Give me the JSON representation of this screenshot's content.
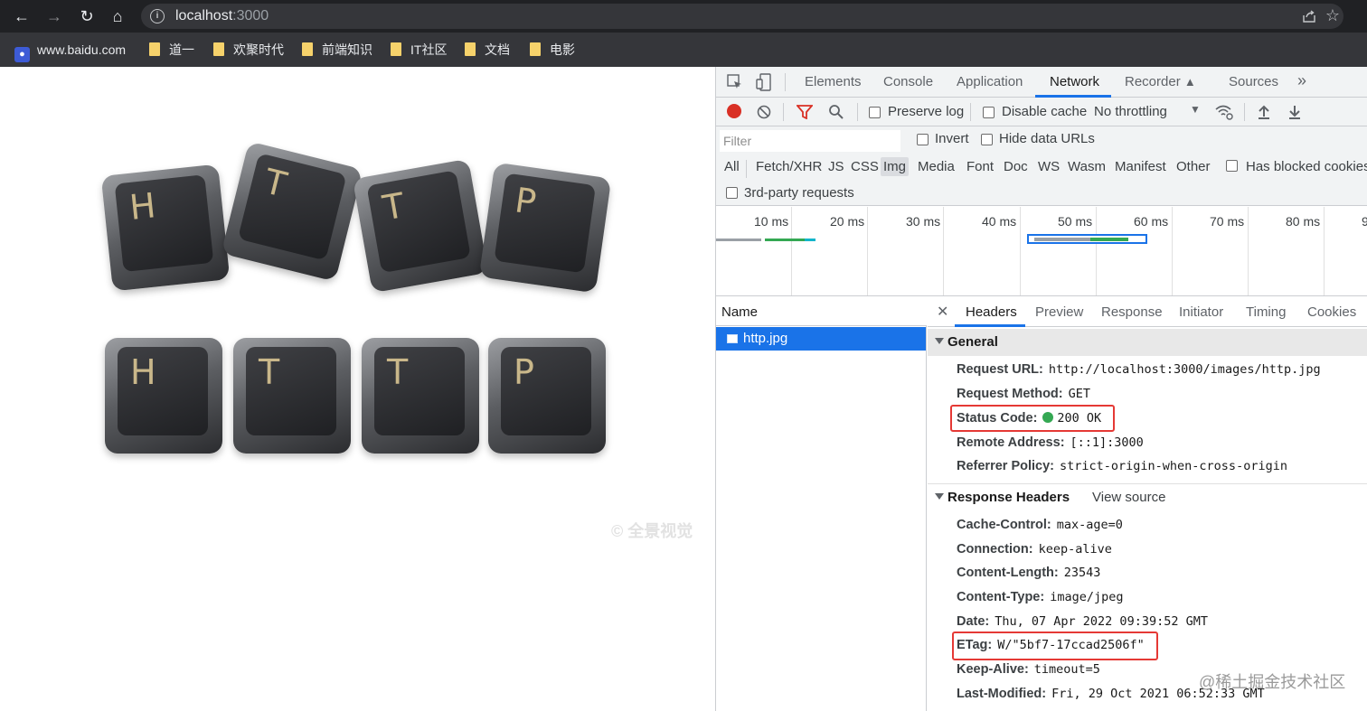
{
  "browser": {
    "url_host": "localhost",
    "url_port": ":3000",
    "bookmarks": [
      "www.baidu.com",
      "道一",
      "欢聚时代",
      "前端知识",
      "IT社区",
      "文档",
      "电影"
    ]
  },
  "page": {
    "keys_row1": [
      "H",
      "T",
      "T",
      "P"
    ],
    "keys_row2": [
      "H",
      "T",
      "T",
      "P"
    ],
    "watermark": "© 全景视觉"
  },
  "devtools": {
    "tabs": [
      "Elements",
      "Console",
      "Application",
      "Network",
      "Recorder",
      "Sources"
    ],
    "active_tab": "Network",
    "toolbar": {
      "preserve_log": "Preserve log",
      "disable_cache": "Disable cache",
      "throttling": "No throttling"
    },
    "filter": {
      "placeholder": "Filter",
      "invert": "Invert",
      "hide_data_urls": "Hide data URLs",
      "types": [
        "All",
        "Fetch/XHR",
        "JS",
        "CSS",
        "Img",
        "Media",
        "Font",
        "Doc",
        "WS",
        "Wasm",
        "Manifest",
        "Other"
      ],
      "active_type": "Img",
      "has_blocked_cookies": "Has blocked cookies",
      "third_party": "3rd-party requests"
    },
    "timeline_labels": [
      "10 ms",
      "20 ms",
      "30 ms",
      "40 ms",
      "50 ms",
      "60 ms",
      "70 ms",
      "80 ms",
      "9"
    ],
    "requests": {
      "name_header": "Name",
      "items": [
        "http.jpg"
      ]
    },
    "detail": {
      "tabs": [
        "Headers",
        "Preview",
        "Response",
        "Initiator",
        "Timing",
        "Cookies"
      ],
      "active_tab": "Headers",
      "general_title": "General",
      "general": [
        {
          "k": "Request URL:",
          "v": "http://localhost:3000/images/http.jpg"
        },
        {
          "k": "Request Method:",
          "v": "GET"
        },
        {
          "k": "Status Code:",
          "v": "200 OK"
        },
        {
          "k": "Remote Address:",
          "v": "[::1]:3000"
        },
        {
          "k": "Referrer Policy:",
          "v": "strict-origin-when-cross-origin"
        }
      ],
      "response_title": "Response Headers",
      "view_source": "View source",
      "response": [
        {
          "k": "Cache-Control:",
          "v": "max-age=0"
        },
        {
          "k": "Connection:",
          "v": "keep-alive"
        },
        {
          "k": "Content-Length:",
          "v": "23543"
        },
        {
          "k": "Content-Type:",
          "v": "image/jpeg"
        },
        {
          "k": "Date:",
          "v": "Thu, 07 Apr 2022 09:39:52 GMT"
        },
        {
          "k": "ETag:",
          "v": "W/\"5bf7-17ccad2506f\""
        },
        {
          "k": "Keep-Alive:",
          "v": "timeout=5"
        },
        {
          "k": "Last-Modified:",
          "v": "Fri, 29 Oct 2021 06:52:33 GMT"
        }
      ]
    }
  },
  "watermark_bottom": "@稀土掘金技术社区",
  "colors": {
    "accent": "#1a73e8",
    "highlight_box": "#e53935",
    "record": "#d93025",
    "status_ok": "#34a853"
  }
}
